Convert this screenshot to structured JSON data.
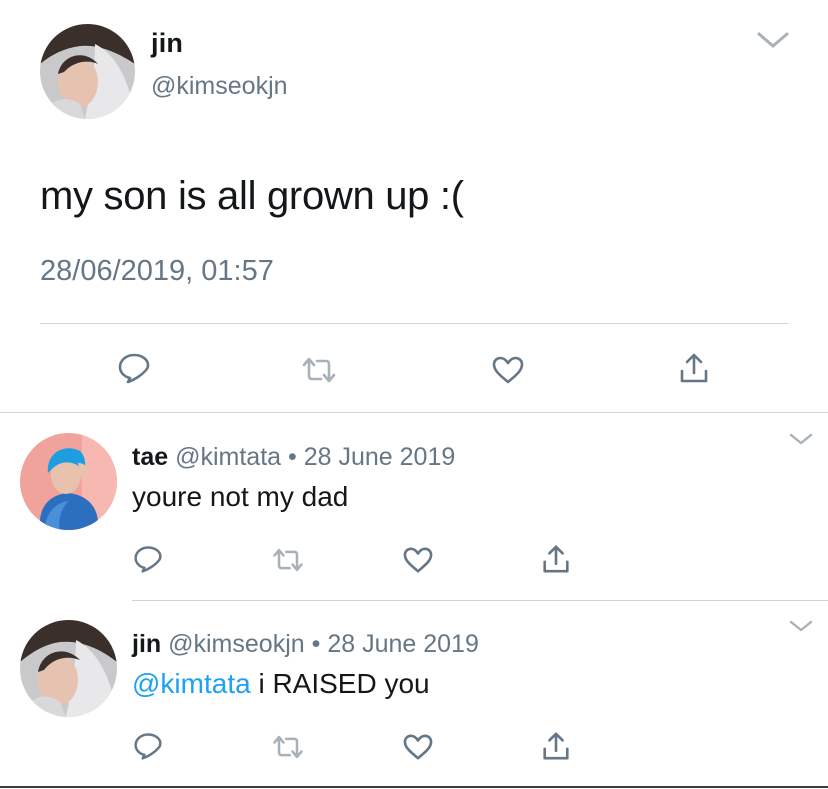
{
  "main_tweet": {
    "author_name": "jin",
    "author_handle": "@kimseokjn",
    "text": "my son is all grown up :(",
    "timestamp": "28/06/2019, 01:57",
    "actions": [
      "reply-icon",
      "retweet-icon",
      "like-icon",
      "share-icon"
    ],
    "menu_icon": "chevron-down-icon"
  },
  "replies": [
    {
      "author_name": "tae",
      "author_handle": "@kimtata",
      "separator": "•",
      "date": "28 June 2019",
      "text": "youre not my dad",
      "mention": "",
      "actions": [
        "reply-icon",
        "retweet-icon",
        "like-icon",
        "share-icon"
      ]
    },
    {
      "author_name": "jin",
      "author_handle": "@kimseokjn",
      "separator": "•",
      "date": "28 June 2019",
      "mention": "@kimtata",
      "text": " i RAISED you",
      "actions": [
        "reply-icon",
        "retweet-icon",
        "like-icon",
        "share-icon"
      ]
    }
  ],
  "colors": {
    "text": "#14171a",
    "secondary": "#657786",
    "link": "#1da1f2",
    "divider": "#cdd5dc",
    "icon": "#657786"
  }
}
